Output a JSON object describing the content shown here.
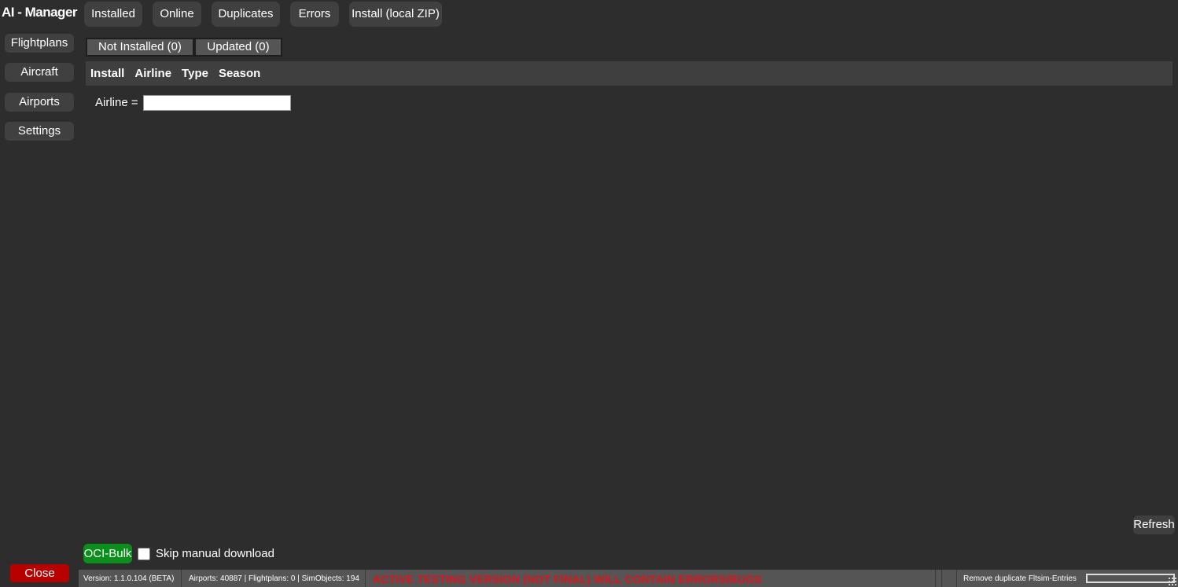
{
  "app": {
    "title": "AI - Manager"
  },
  "top_nav": {
    "installed": "Installed",
    "online": "Online",
    "duplicates": "Duplicates",
    "errors": "Errors",
    "install_zip": "Install (local ZIP)"
  },
  "sidebar": {
    "flightplans": "Flightplans",
    "aircraft": "Aircraft",
    "airports": "Airports",
    "settings": "Settings"
  },
  "subtabs": {
    "not_installed": "Not Installed (0)",
    "updated": "Updated (0)"
  },
  "table": {
    "columns": [
      "Install",
      "Airline",
      "Type",
      "Season"
    ],
    "rows": []
  },
  "filter": {
    "label": "Airline =",
    "value": ""
  },
  "actions": {
    "refresh": "Refresh",
    "oci_bulk": "OCI-Bulk",
    "skip_manual_download": "Skip manual download",
    "skip_manual_download_checked": false,
    "close": "Close"
  },
  "statusbar": {
    "version": "Version: 1.1.0.104 (BETA)",
    "counts": "Airports: 40887 | Flightplans: 0 | SimObjects: 194",
    "warning": "ACTIVE TESTING VERSION (NOT FINAL) WILL CONTAIN ERRORS/BUGS",
    "task": "Remove duplicate Fltsim-Entries",
    "progress": 0
  },
  "colors": {
    "background": "#2d2d2d",
    "button": "#404040",
    "oci_green": "#0a8f1a",
    "close_red": "#b80000",
    "warning_red": "#e0131a"
  }
}
